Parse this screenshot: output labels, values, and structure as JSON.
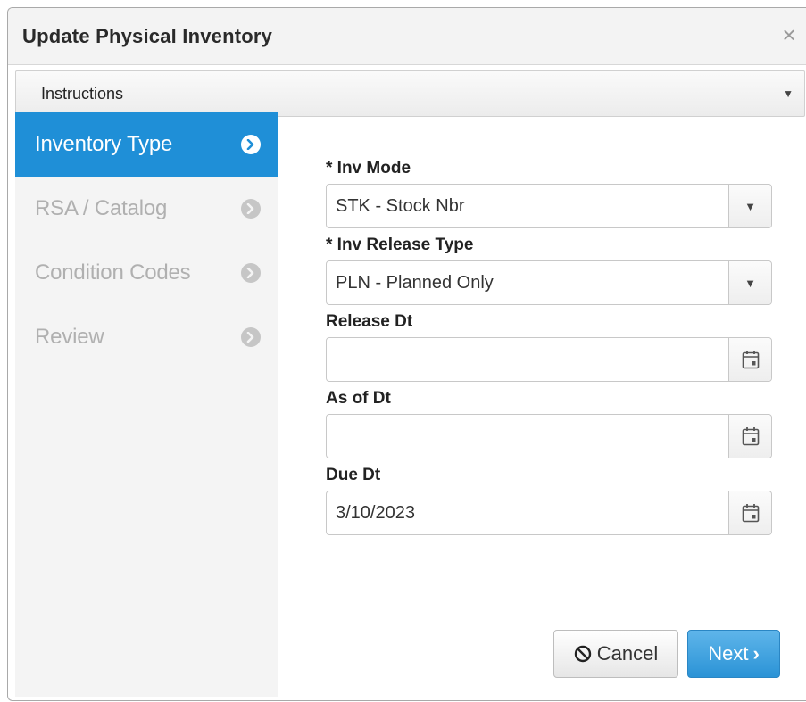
{
  "dialog": {
    "title": "Update Physical Inventory",
    "close_icon": "×"
  },
  "instructions": {
    "label": "Instructions",
    "caret": "▼"
  },
  "wizard": {
    "steps": [
      {
        "label": "Inventory Type",
        "active": true
      },
      {
        "label": "RSA / Catalog",
        "active": false
      },
      {
        "label": "Condition Codes",
        "active": false
      },
      {
        "label": "Review",
        "active": false
      }
    ]
  },
  "form": {
    "inv_mode": {
      "label": "* Inv Mode",
      "value": "STK - Stock Nbr",
      "caret": "▼"
    },
    "inv_release_type": {
      "label": "* Inv Release Type",
      "value": "PLN - Planned Only",
      "caret": "▼"
    },
    "release_dt": {
      "label": "Release Dt",
      "value": ""
    },
    "as_of_dt": {
      "label": "As of Dt",
      "value": ""
    },
    "due_dt": {
      "label": "Due Dt",
      "value": "3/10/2023"
    }
  },
  "buttons": {
    "cancel_label": "Cancel",
    "next_label": "Next",
    "next_chevron": "›"
  },
  "colors": {
    "accent": "#1f8fd7",
    "next_button": "#3a9fe0",
    "nav_bg": "#f4f4f4"
  }
}
